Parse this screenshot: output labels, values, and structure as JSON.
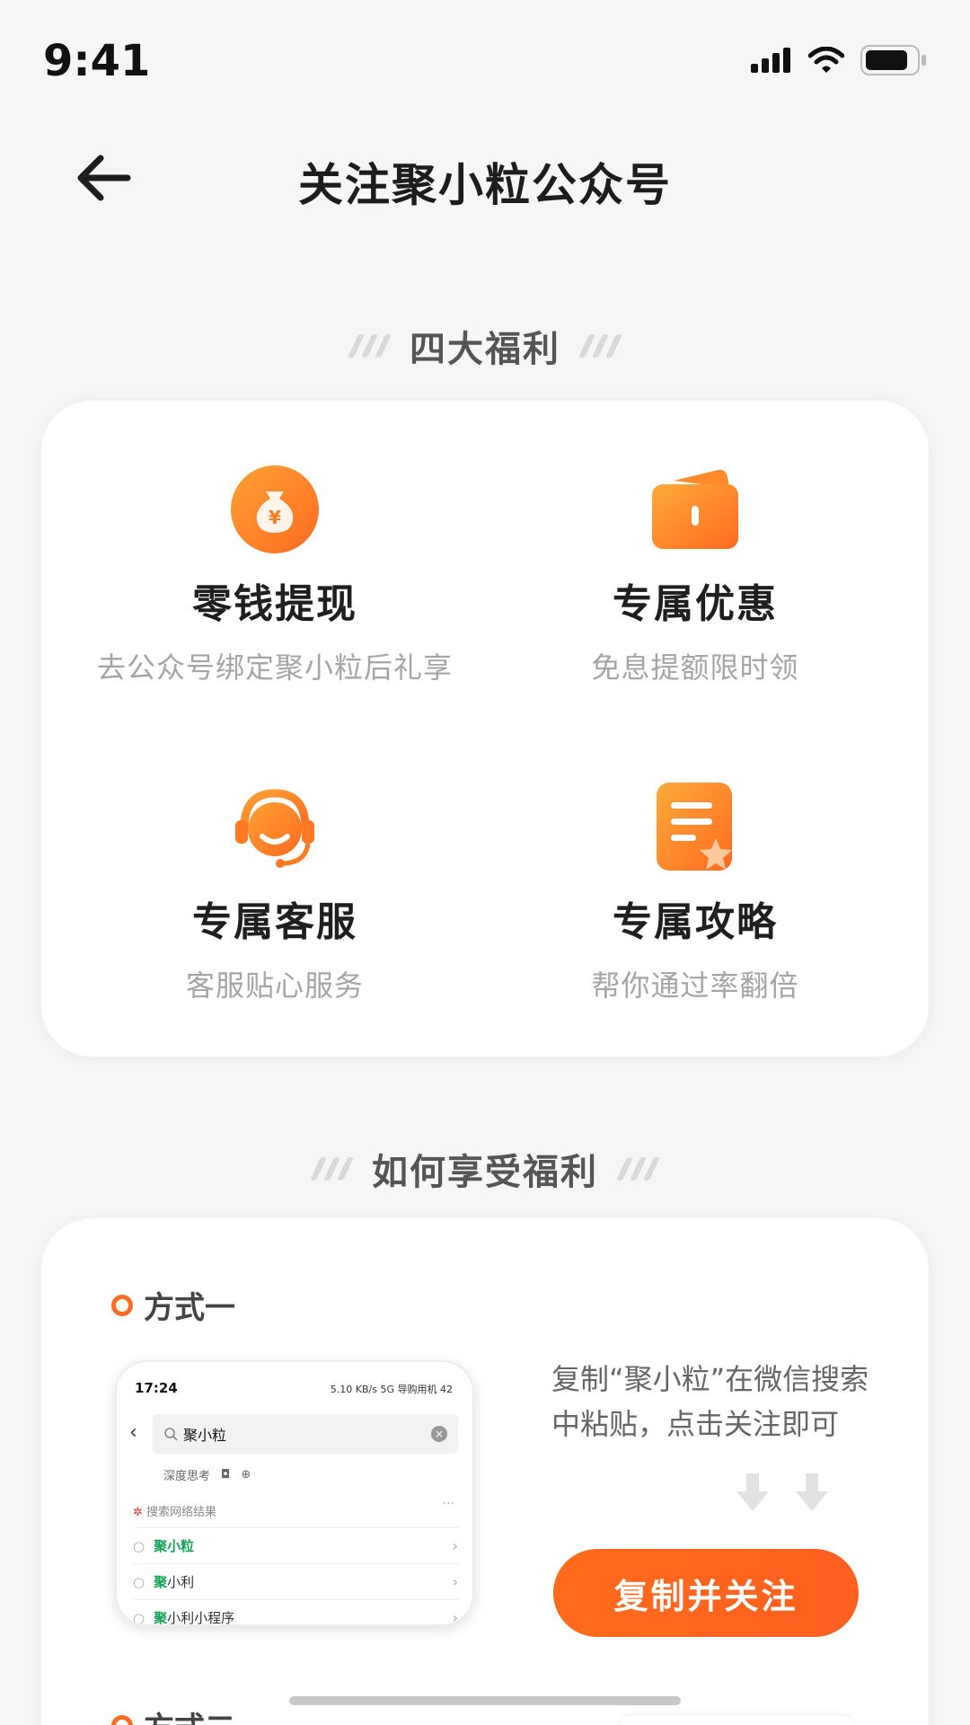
{
  "status_bar": {
    "time": "9:41"
  },
  "nav": {
    "title": "关注聚小粒公众号"
  },
  "benefits": {
    "heading": "四大福利",
    "items": [
      {
        "icon": "money-bag-icon",
        "title": "零钱提现",
        "desc": "去公众号绑定聚小粒后礼享"
      },
      {
        "icon": "coupon-wallet-icon",
        "title": "专属优惠",
        "desc": "免息提额限时领"
      },
      {
        "icon": "headset-icon",
        "title": "专属客服",
        "desc": "客服贴心服务"
      },
      {
        "icon": "document-star-icon",
        "title": "专属攻略",
        "desc": "帮你通过率翻倍"
      }
    ]
  },
  "howto": {
    "heading": "如何享受福利",
    "method_one": "方式一",
    "method_two": "方式二",
    "desc": "复制“聚小粒”在微信搜索中粘贴，点击关注即可",
    "button": "复制并关注",
    "mock": {
      "time": "17:24",
      "status_right": "5.10 KB/s 5G 导购用机 42",
      "search_text": "聚小粒",
      "deep_think": "深度思考",
      "web_results": "搜索网络结果",
      "results": [
        {
          "highlight": "聚小粒",
          "rest": ""
        },
        {
          "highlight": "聚",
          "rest": "小利"
        },
        {
          "highlight": "聚",
          "rest": "小利小程序"
        }
      ]
    }
  },
  "colors": {
    "accent": "#ff6a24",
    "accent_light": "#ffa13a"
  }
}
